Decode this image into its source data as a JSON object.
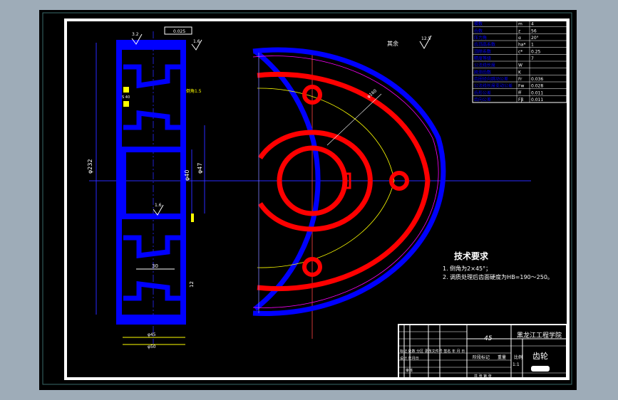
{
  "colors": {
    "workspace": "#9eacb8",
    "canvas": "#000000",
    "paper": "#ffffff",
    "red": "#ff0000",
    "blue": "#0000ff",
    "yellow": "#ffff00",
    "magenta": "#ff00ff",
    "white": "#ffffff"
  },
  "annotations": {
    "rest_roughness": "其余",
    "roughness_rest_value": "12.5",
    "roughness_top_value": "3.2",
    "roughness_right_value": "1.6",
    "roughness_mid_value": "1.6",
    "gdt_frame": "0.025",
    "chamfer_note": "倒角1.5",
    "web_label": "S 40",
    "dim_outer": "φ232",
    "dim_hub": "φ47",
    "dim_bore": "φ40",
    "dim_web": "30",
    "dim_rim": "12",
    "dim_bottom_1": "φ45",
    "dim_bottom_2": "φ50",
    "pcd": "φ160"
  },
  "params_table": {
    "rows": [
      [
        "模数",
        "m",
        "4"
      ],
      [
        "齿数",
        "z",
        "56"
      ],
      [
        "压力角",
        "α",
        "20°"
      ],
      [
        "齿顶高系数",
        "ha*",
        "1"
      ],
      [
        "顶隙系数",
        "c*",
        "0.25"
      ],
      [
        "精度等级",
        "",
        "7"
      ],
      [
        "公法线长度",
        "W",
        ""
      ],
      [
        "跨测齿数",
        "K",
        ""
      ],
      [
        "齿圈径向跳动公差",
        "Fr",
        "0.036"
      ],
      [
        "公法线长度变动公差",
        "Fw",
        "0.028"
      ],
      [
        "齿形公差",
        "ff",
        "0.011"
      ],
      [
        "齿向公差",
        "Fβ",
        "0.011"
      ]
    ]
  },
  "tech_requirements": {
    "title": "技术要求",
    "items": [
      "1. 倒角为2×45°；",
      "2. 调质处理后齿面硬度为HB=190～250。"
    ]
  },
  "title_block": {
    "material": "45",
    "school": "黑龙江工程学院",
    "part_name": "齿轮",
    "row1": "标记 处数  分区 更改文件号 签名  年 月 日",
    "row2": "设计  年月日",
    "stage_label": "阶段标记",
    "weight_label": "重量",
    "scale_label": "比例",
    "audit": "审核",
    "sheet": "共 张  第 张",
    "scale_value": "1:1"
  }
}
